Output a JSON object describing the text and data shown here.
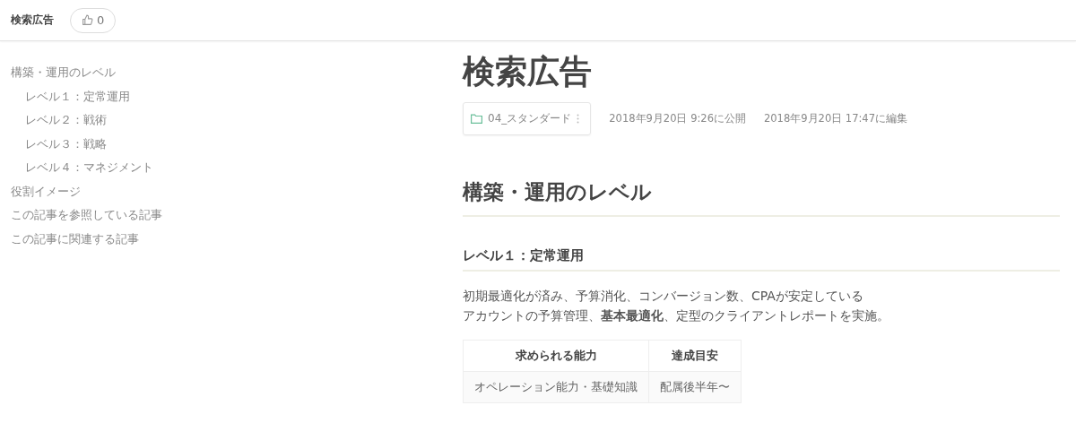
{
  "header": {
    "title": "検索広告",
    "like_count": "0"
  },
  "toc": [
    {
      "label": "構築・運用のレベル",
      "children": [
        {
          "label": "レベル１：定常運用"
        },
        {
          "label": "レベル２：戦術"
        },
        {
          "label": "レベル３：戦略"
        },
        {
          "label": "レベル４：マネジメント"
        }
      ]
    },
    {
      "label": "役割イメージ"
    },
    {
      "label": "この記事を参照している記事"
    },
    {
      "label": "この記事に関連する記事"
    }
  ],
  "article": {
    "title": "検索広告",
    "folder": "04_スタンダード",
    "published": "2018年9月20日 9:26に公開",
    "edited": "2018年9月20日 17:47に編集",
    "blocks": [
      {
        "kind": "h2",
        "text": "構築・運用のレベル"
      },
      {
        "kind": "h3",
        "text": "レベル１：定常運用"
      },
      {
        "kind": "p",
        "lines": [
          "初期最適化が済み、予算消化、コンバージョン数、CPAが安定している",
          "アカウントの予算管理、**基本最適化**、定型のクライアントレポートを実施。"
        ]
      },
      {
        "kind": "table",
        "columns": [
          "求められる能力",
          "達成目安"
        ],
        "rows": [
          [
            "オペレーション能力・基礎知識",
            "配属後半年〜"
          ]
        ]
      }
    ]
  }
}
